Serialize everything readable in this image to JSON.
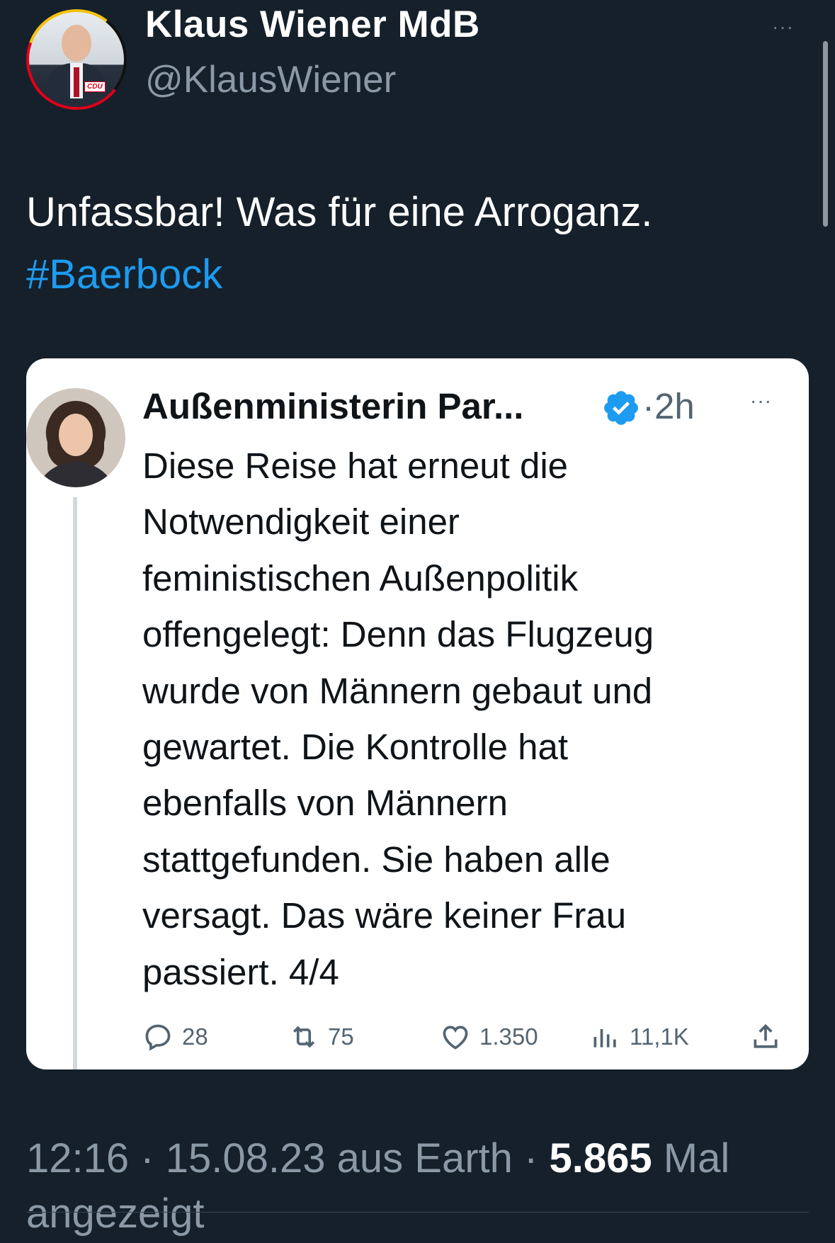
{
  "tweet": {
    "author_name": "Klaus Wiener MdB",
    "author_handle": "@KlausWiener",
    "avatar_badge": "CDU",
    "more_label": "···",
    "text": "Unfassbar!  Was für eine Arroganz.",
    "hashtag": "#Baerbock"
  },
  "quote": {
    "author_name": "Außenministerin Par...",
    "separator": "·",
    "time": "2h",
    "more_label": "···",
    "body": "Diese Reise hat erneut die\nNotwendigkeit einer\nfeministischen Außenpolitik\noffengelegt: Denn das Flugzeug\nwurde von Männern gebaut und\ngewartet. Die Kontrolle hat\nebenfalls von Männern\nstattgefunden. Sie haben alle\nversagt. Das wäre keiner Frau\npassiert. 4/4",
    "actions": {
      "replies": "28",
      "retweets": "75",
      "likes": "1.350",
      "views": "11,1K"
    },
    "icons": [
      "reply-icon",
      "retweet-icon",
      "heart-icon",
      "views-icon",
      "share-icon",
      "verified-icon"
    ]
  },
  "footer": {
    "time": "12:16",
    "separator": "·",
    "date": "15.08.23",
    "source": "aus Earth",
    "views_count": "5.865",
    "views_label_part1": "Mal",
    "views_label_part2": "angezeigt"
  },
  "colors": {
    "background": "#15202b",
    "accent": "#1d9bf0",
    "muted": "#8b98a5",
    "card": "#ffffff"
  }
}
